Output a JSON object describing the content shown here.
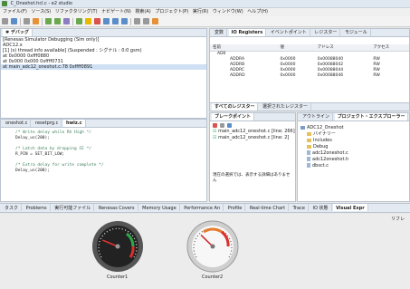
{
  "window": {
    "title": "C_Oneshot.hcl.c - e2 studio"
  },
  "menu": [
    "ファイル(F)",
    "ソース(S)",
    "リファクタリング(T)",
    "ナビゲート(N)",
    "検索(A)",
    "プロジェクト(P)",
    "実行(R)",
    "ウィンドウ(W)",
    "ヘルプ(H)"
  ],
  "debug_panel": {
    "lines": [
      "[Renesas Simulator Debugging (Sim only)]",
      "ADC12.x",
      "  [1] (s) thread info available] (Suspended : シグナル : 0:0 gsm)",
      "    at 0x0000 0xfff0880",
      "    at 0x000 0x000 0xffff0731",
      "  at main_adc12_oneshot.c:78 0xffff0891"
    ]
  },
  "registers": {
    "tabs": [
      "変数",
      "IO Registers",
      "イベントポイント",
      "レジスター",
      "モジュール"
    ],
    "headers": [
      "名前",
      "値",
      "アドレス",
      "アクセス"
    ],
    "group": "AD0",
    "rows": [
      {
        "name": "ADDRA",
        "value": "0x0000",
        "address": "0x00088040",
        "access": "RW"
      },
      {
        "name": "ADDRB",
        "value": "0x0000",
        "address": "0x00088042",
        "access": "RW"
      },
      {
        "name": "ADDRC",
        "value": "0x0000",
        "address": "0x00088044",
        "access": "RW"
      },
      {
        "name": "ADDRD",
        "value": "0x0000",
        "address": "0x00088046",
        "access": "RW"
      }
    ],
    "bottom_tabs": [
      "すべてのレジスター",
      "選択されたレジスター"
    ]
  },
  "editor": {
    "tabs": [
      "oneshot.c",
      "resetprg.c",
      "hwiz.c"
    ],
    "lines": [
      {
        "text": "  /* Write delay while Rh High */",
        "comment": true
      },
      {
        "text": "  Delay_us(200);",
        "comment": false
      },
      {
        "text": "",
        "comment": false
      },
      {
        "text": "  /* Latch data by dropping CE */",
        "comment": true
      },
      {
        "text": "  R_PIN = SET_BIT_LOW;",
        "comment": false
      },
      {
        "text": "",
        "comment": false
      },
      {
        "text": "  /* Extra delay for write complete */",
        "comment": true
      },
      {
        "text": "  Delay_us(200);",
        "comment": false
      }
    ]
  },
  "breakpoints": {
    "tab": "ブレークポイント",
    "items": [
      "main_adc12_oneshot.c [line: 266]",
      "main_adc12_oneshot.c [line: 2]"
    ],
    "note": "現在の選択では、表示する詳細はありません"
  },
  "project_explorer": {
    "tabs": [
      "アウトライン",
      "プロジェクト・エクスプローラー"
    ],
    "root": "ADC12_Oneshot",
    "items": [
      {
        "label": "バイナリー",
        "kind": "folder"
      },
      {
        "label": "Includes",
        "kind": "folder"
      },
      {
        "label": "Debug",
        "kind": "folder"
      },
      {
        "label": "adc12oneshot.c",
        "kind": "file"
      },
      {
        "label": "adc12oneshot.h",
        "kind": "file"
      },
      {
        "label": "dbsct.c",
        "kind": "file"
      }
    ]
  },
  "bottom_tabs": [
    "タスク",
    "Problems",
    "実行可能ファイル",
    "Renesas Covers",
    "Memory Usage",
    "Performance An",
    "Profile",
    "Real-time Chart",
    "Trace",
    "IO 状態",
    "Visual Expr"
  ],
  "bottom_right_label": "リフレ",
  "gauges": [
    {
      "label": "Counter1",
      "value": 25,
      "style": "dark"
    },
    {
      "label": "Counter2",
      "value": 33,
      "style": "light"
    }
  ]
}
